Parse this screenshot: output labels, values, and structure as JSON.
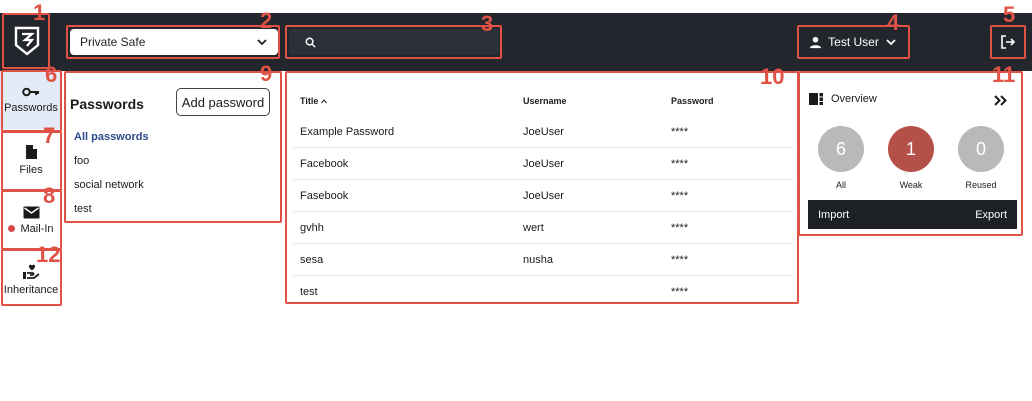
{
  "topbar": {
    "safe_select": {
      "value": "Private Safe"
    },
    "search": {
      "placeholder": ""
    },
    "user": {
      "name": "Test User"
    }
  },
  "sidebar": {
    "items": [
      {
        "label": "Passwords",
        "icon": "key-icon"
      },
      {
        "label": "Files",
        "icon": "file-icon"
      },
      {
        "label": "Mail-In",
        "icon": "mail-icon"
      },
      {
        "label": "Inheritance",
        "icon": "heart-hand-icon"
      }
    ]
  },
  "passwords_panel": {
    "title": "Passwords",
    "add_button": "Add password",
    "filters": [
      "All passwords",
      "foo",
      "social network",
      "test"
    ]
  },
  "table": {
    "columns": [
      "Title",
      "Username",
      "Password"
    ],
    "rows": [
      {
        "title": "Example Password",
        "username": "JoeUser",
        "password": "****"
      },
      {
        "title": "Facebook",
        "username": "JoeUser",
        "password": "****"
      },
      {
        "title": "Fasebook",
        "username": "JoeUser",
        "password": "****"
      },
      {
        "title": "gvhh",
        "username": "wert",
        "password": "****"
      },
      {
        "title": "sesa",
        "username": "nusha",
        "password": "****"
      },
      {
        "title": "test",
        "username": "",
        "password": "****"
      }
    ]
  },
  "overview": {
    "title": "Overview",
    "stats": [
      {
        "count": "6",
        "label": "All",
        "color": "#b9b9b9"
      },
      {
        "count": "1",
        "label": "Weak",
        "color": "#b55048"
      },
      {
        "count": "0",
        "label": "Reused",
        "color": "#b9b9b9"
      }
    ],
    "import_label": "Import",
    "export_label": "Export"
  },
  "callouts": [
    "1",
    "2",
    "3",
    "4",
    "5",
    "6",
    "7",
    "8",
    "9",
    "10",
    "11",
    "12"
  ],
  "colors": {
    "topbar": "#23262d",
    "callout": "#e05246",
    "active_nav": "#e3ebf9"
  }
}
